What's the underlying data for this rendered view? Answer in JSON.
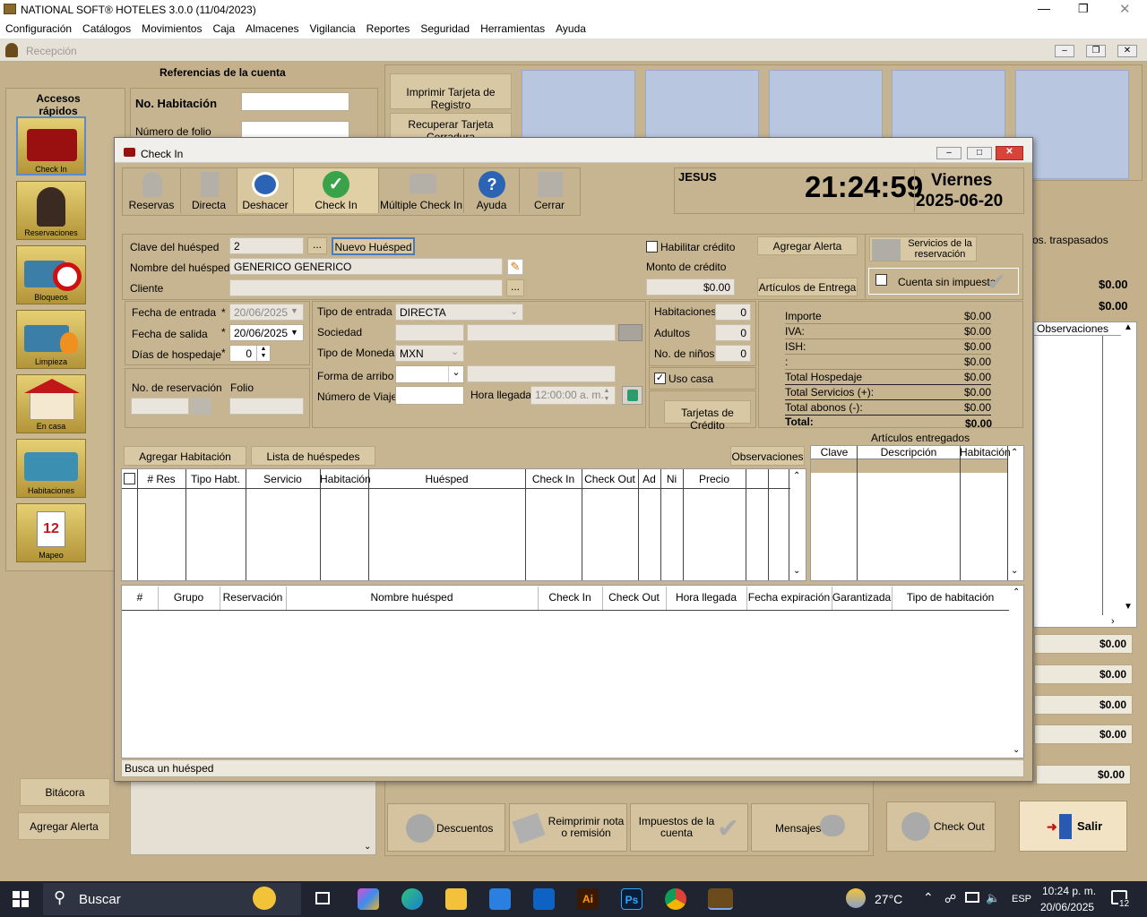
{
  "app": {
    "title": "NATIONAL SOFT® HOTELES 3.0.0 (11/04/2023)",
    "menu": [
      "Configuración",
      "Catálogos",
      "Movimientos",
      "Caja",
      "Almacenes",
      "Vigilancia",
      "Reportes",
      "Seguridad",
      "Herramientas",
      "Ayuda"
    ],
    "subwindow_title": "Recepción"
  },
  "background": {
    "references_title": "Referencias de la cuenta",
    "accesos_title": "Accesos rápidos",
    "no_habitacion_label": "No. Habitación",
    "numero_folio_label": "Número de folio",
    "imprimir_tarjeta": "Imprimir Tarjeta de Registro",
    "recuperar_tarjeta": "Recuperar Tarjeta Cerradura",
    "traspasados": "os. traspasados",
    "totals_top": [
      "$0.00",
      "$0.00"
    ],
    "observaciones_header": "Observaciones",
    "right_values": [
      "$0.00",
      "$0.00",
      "$0.00",
      "$0.00",
      "$0.00"
    ],
    "side_items": [
      "Check In",
      "Reservaciones",
      "Bloqueos",
      "Limpieza",
      "En casa",
      "Habitaciones",
      "Mapeo"
    ],
    "bitacora": "Bitácora",
    "agregar_alerta": "Agregar Alerta",
    "bottom_buttons": [
      "Descuentos",
      "Reimprimir nota o remisión",
      "Impuestos de la cuenta",
      "Mensajes",
      "Check Out",
      "Salir"
    ]
  },
  "dialog": {
    "title": "Check In",
    "toolbar": [
      "Reservas",
      "Directa",
      "Deshacer",
      "Check In",
      "Múltiple Check In",
      "Ayuda",
      "Cerrar"
    ],
    "user": "JESUS",
    "time": "21:24:59",
    "day": "Viernes",
    "date": "2025-06-20",
    "guest": {
      "clave_label": "Clave del huésped",
      "clave_value": "2",
      "nuevo_huesped": "Nuevo Huésped",
      "nombre_label": "Nombre del huésped *",
      "nombre_value": "GENERICO  GENERICO",
      "cliente_label": "Cliente",
      "habilitar_credito": "Habilitar crédito",
      "agregar_alerta": "Agregar Alerta",
      "monto_credito_label": "Monto de crédito",
      "monto_credito_value": "$0.00",
      "articulos_entrega": "Artículos de Entrega",
      "servicios_reservacion": "Servicios de la reservación",
      "cuenta_sin_impuesto": "Cuenta sin impuesto"
    },
    "dates": {
      "fecha_entrada_label": "Fecha de entrada",
      "fecha_entrada_value": "20/06/2025",
      "fecha_salida_label": "Fecha de salida",
      "fecha_salida_value": "20/06/2025",
      "dias_label": "Días de hospedaje",
      "dias_value": "0",
      "no_reservacion_label": "No. de reservación",
      "folio_label": "Folio"
    },
    "entry": {
      "tipo_entrada_label": "Tipo de entrada",
      "tipo_entrada_value": "DIRECTA",
      "sociedad_label": "Sociedad",
      "tipo_moneda_label": "Tipo de Moneda",
      "tipo_moneda_value": "MXN",
      "forma_arribo_label": "Forma de arribo",
      "numero_viaje_label": "Número de Viaje",
      "hora_llegada_label": "Hora llegada",
      "hora_llegada_value": "12:00:00 a. m."
    },
    "counts": {
      "habitaciones_label": "Habitaciones",
      "habitaciones_value": "0",
      "adultos_label": "Adultos",
      "adultos_value": "0",
      "ninos_label": "No. de niños",
      "ninos_value": "0",
      "uso_casa": "Uso casa",
      "tarjetas_credito": "Tarjetas de Crédito"
    },
    "totals": {
      "importe_label": "Importe",
      "importe": "$0.00",
      "iva_label": "IVA:",
      "iva": "$0.00",
      "ish_label": "ISH:",
      "ish": "$0.00",
      "blank_label": ":",
      "blank": "$0.00",
      "hospedaje_label": "Total Hospedaje",
      "hospedaje": "$0.00",
      "servicios_label": "Total Servicios (+):",
      "servicios": "$0.00",
      "abonos_label": "Total abonos (-):",
      "abonos": "$0.00",
      "total_label": "Total:",
      "total": "$0.00"
    },
    "buttons": {
      "agregar_habitacion": "Agregar Habitación",
      "lista_huespedes": "Lista de huéspedes",
      "observaciones": "Observaciones"
    },
    "articulos_title": "Artículos entregados",
    "articulos_columns": [
      "Clave",
      "Descripción",
      "Habitación"
    ],
    "rooms_columns": [
      "# Res",
      "Tipo Habt.",
      "Servicio",
      "Habitación",
      "Huésped",
      "Check In",
      "Check Out",
      "Ad",
      "Ni",
      "Precio"
    ],
    "list_columns": [
      "#",
      "Grupo",
      "Reservación",
      "Nombre huésped",
      "Check In",
      "Check Out",
      "Hora llegada",
      "Fecha expiración",
      "Garantizada",
      "Tipo de habitación"
    ],
    "status": "Busca un huésped"
  },
  "taskbar": {
    "search": "Buscar",
    "temp": "27°C",
    "lang": "ESP",
    "time": "10:24 p. m.",
    "date": "20/06/2025",
    "notif": "12"
  }
}
